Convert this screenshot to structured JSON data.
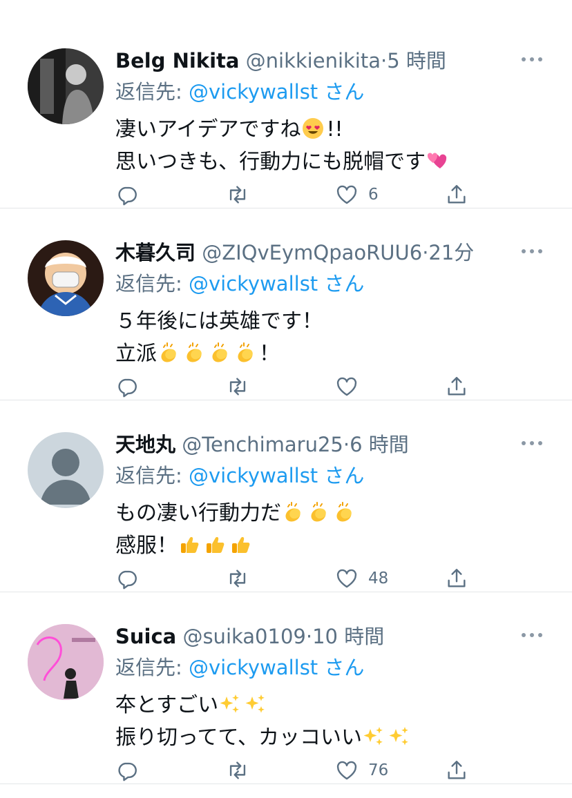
{
  "tweets": [
    {
      "name": "Belg Nikita",
      "handle": "@nikkienikita",
      "dot": "·",
      "time": "5 時間",
      "reply_prefix": "返信先: ",
      "reply_mention": "@vickywallst",
      "reply_suffix": "さん",
      "line1": "凄いアイデアですね",
      "line1_tail": "!!",
      "line2": "思いつきも、行動力にも脱帽です",
      "like_count": "6",
      "emoji": [
        "heart-eyes-face",
        "two-hearts"
      ]
    },
    {
      "name": "木暮久司",
      "handle": "@ZIQvEymQpaoRUU6",
      "dot": "·",
      "time": "21分",
      "reply_prefix": "返信先: ",
      "reply_mention": "@vickywallst",
      "reply_suffix": "さん",
      "line1": "５年後には英雄です！",
      "line2": "立派",
      "line2_tail": "！",
      "like_count": "",
      "emoji": [
        "clapping-hands"
      ]
    },
    {
      "name": "天地丸",
      "handle": "@Tenchimaru25",
      "dot": "·",
      "time": "6 時間",
      "reply_prefix": "返信先: ",
      "reply_mention": "@vickywallst",
      "reply_suffix": "さん",
      "line1": "もの凄い行動力だ",
      "line2": "感服！",
      "like_count": "48",
      "emoji": [
        "clapping-hands",
        "thumbs-up"
      ]
    },
    {
      "name": "Suica",
      "handle": "@suika0109",
      "dot": "·",
      "time": "10 時間",
      "reply_prefix": "返信先: ",
      "reply_mention": "@vickywallst",
      "reply_suffix": "さん",
      "line1": "夲とすごい",
      "line2": "振り切ってて、カッコいい",
      "like_count": "76",
      "emoji": [
        "sparkles"
      ]
    }
  ],
  "colors": {
    "text": "#0f1419",
    "secondary": "#5b7083",
    "link": "#1d9bf0",
    "divider": "#e3e6e8"
  },
  "icons": [
    "reply-icon",
    "retweet-icon",
    "like-icon",
    "share-icon",
    "more-icon"
  ]
}
